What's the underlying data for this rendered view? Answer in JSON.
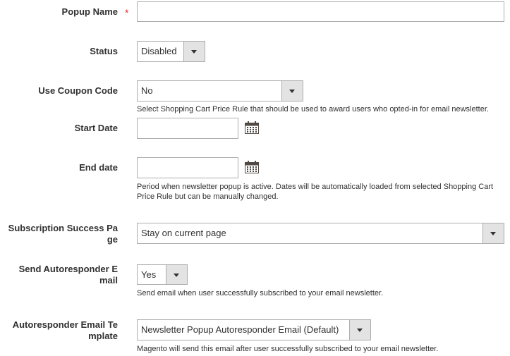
{
  "fields": {
    "popup_name": {
      "label": "Popup Name",
      "required_mark": "*",
      "value": ""
    },
    "status": {
      "label": "Status",
      "value": "Disabled"
    },
    "use_coupon": {
      "label": "Use Coupon Code",
      "value": "No",
      "note": "Select Shopping Cart Price Rule that should be used to award users who opted-in for email newsletter."
    },
    "start_date": {
      "label": "Start Date",
      "value": ""
    },
    "end_date": {
      "label": "End date",
      "value": "",
      "note_line1": "Period when newsletter popup is active. Dates will be automatically loaded from selected Shopping Cart",
      "note_line2": "Price Rule but can be manually changed."
    },
    "success_page": {
      "label_line1": "Subscription Success Pa",
      "label_line2": "ge",
      "value": "Stay on current page"
    },
    "send_autoresponder": {
      "label_line1": "Send Autoresponder E",
      "label_line2": "mail",
      "value": "Yes",
      "note": "Send email when user successfully subscribed to your email newsletter."
    },
    "autoresponder_template": {
      "label_line1": "Autoresponder Email Te",
      "label_line2": "mplate",
      "value": "Newsletter Popup Autoresponder Email (Default)",
      "note": "Magento will send this email after user successfully subscribed to your email newsletter."
    }
  },
  "icons": {
    "calendar": "calendar-icon",
    "dropdown": "chevron-down-icon",
    "required": "required-asterisk"
  },
  "colors": {
    "required": "#e02b27",
    "border": "#adadad",
    "select_button": "#e3e3e3",
    "text": "#303030"
  }
}
